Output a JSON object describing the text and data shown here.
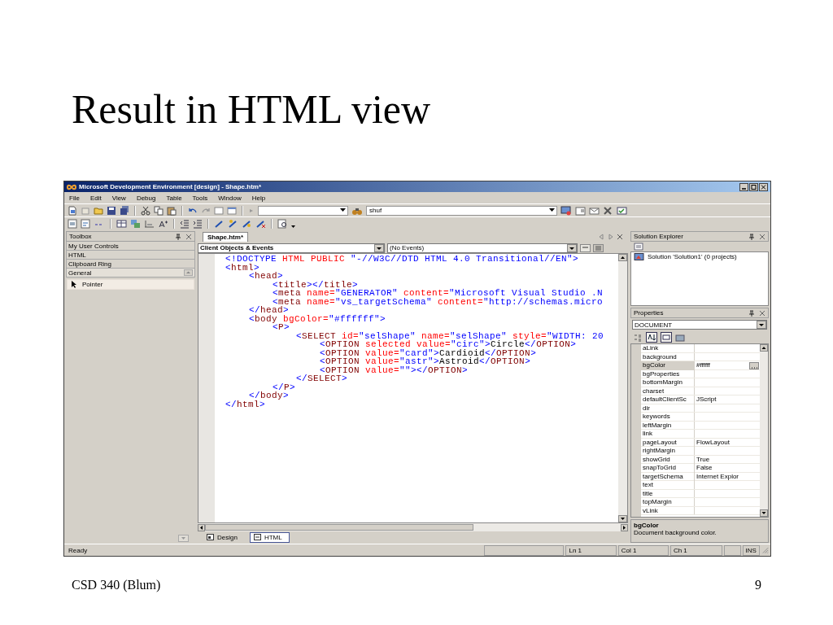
{
  "slide": {
    "title": "Result in HTML view",
    "footer": "CSD 340 (Blum)",
    "page_number": "9"
  },
  "window": {
    "title": "Microsoft Development Environment [design] - Shape.htm*"
  },
  "menu": [
    "File",
    "Edit",
    "View",
    "Debug",
    "Table",
    "Tools",
    "Window",
    "Help"
  ],
  "find_field": {
    "value": "shuf"
  },
  "toolbox": {
    "title": "Toolbox",
    "tabs": [
      {
        "label": "My User Controls",
        "selected": false
      },
      {
        "label": "HTML",
        "selected": false
      },
      {
        "label": "Clipboard Ring",
        "selected": false
      },
      {
        "label": "General",
        "selected": true
      }
    ],
    "items": [
      {
        "label": "Pointer",
        "selected": true
      }
    ]
  },
  "editor": {
    "tabs": [
      {
        "label": "Shape.htm*",
        "selected": true
      }
    ],
    "object_dropdown": "Client Objects & Events",
    "event_dropdown": "(No Events)",
    "code": [
      {
        "tokens": [
          {
            "kind": "bracket",
            "text": "<!DOCTYPE"
          },
          {
            "kind": "attr",
            "text": " HTML PUBLIC "
          },
          {
            "kind": "value",
            "text": "\"-//W3C//DTD HTML 4.0 Transitional//EN\""
          },
          {
            "kind": "bracket",
            "text": ">"
          }
        ]
      },
      {
        "tokens": [
          {
            "kind": "bracket",
            "text": "<"
          },
          {
            "kind": "tag",
            "text": "html"
          },
          {
            "kind": "bracket",
            "text": ">"
          }
        ],
        "children": [
          {
            "tokens": [
              {
                "kind": "bracket",
                "text": "<"
              },
              {
                "kind": "tag",
                "text": "head"
              },
              {
                "kind": "bracket",
                "text": ">"
              }
            ],
            "children": [
              {
                "tokens": [
                  {
                    "kind": "bracket",
                    "text": "<"
                  },
                  {
                    "kind": "tag",
                    "text": "title"
                  },
                  {
                    "kind": "bracket",
                    "text": "></"
                  },
                  {
                    "kind": "tag",
                    "text": "title"
                  },
                  {
                    "kind": "bracket",
                    "text": ">"
                  }
                ]
              },
              {
                "tokens": [
                  {
                    "kind": "bracket",
                    "text": "<"
                  },
                  {
                    "kind": "tag",
                    "text": "meta"
                  },
                  {
                    "kind": "attr",
                    "text": " name="
                  },
                  {
                    "kind": "value",
                    "text": "\"GENERATOR\""
                  },
                  {
                    "kind": "attr",
                    "text": " content="
                  },
                  {
                    "kind": "value",
                    "text": "\"Microsoft Visual Studio .N"
                  }
                ]
              },
              {
                "tokens": [
                  {
                    "kind": "bracket",
                    "text": "<"
                  },
                  {
                    "kind": "tag",
                    "text": "meta"
                  },
                  {
                    "kind": "attr",
                    "text": " name="
                  },
                  {
                    "kind": "value",
                    "text": "\"vs_targetSchema\""
                  },
                  {
                    "kind": "attr",
                    "text": " content="
                  },
                  {
                    "kind": "value",
                    "text": "\"http://schemas.micro"
                  }
                ]
              }
            ]
          },
          {
            "tokens": [
              {
                "kind": "bracket",
                "text": "</"
              },
              {
                "kind": "tag",
                "text": "head"
              },
              {
                "kind": "bracket",
                "text": ">"
              }
            ]
          },
          {
            "tokens": [
              {
                "kind": "bracket",
                "text": "<"
              },
              {
                "kind": "tag",
                "text": "body"
              },
              {
                "kind": "attr",
                "text": " bgColor="
              },
              {
                "kind": "value",
                "text": "\"#ffffff\""
              },
              {
                "kind": "bracket",
                "text": ">"
              }
            ],
            "children": [
              {
                "tokens": [
                  {
                    "kind": "bracket",
                    "text": "<"
                  },
                  {
                    "kind": "tag",
                    "text": "P"
                  },
                  {
                    "kind": "bracket",
                    "text": ">"
                  }
                ],
                "children": [
                  {
                    "tokens": [
                      {
                        "kind": "bracket",
                        "text": "<"
                      },
                      {
                        "kind": "tag",
                        "text": "SELECT"
                      },
                      {
                        "kind": "attr",
                        "text": " id="
                      },
                      {
                        "kind": "value",
                        "text": "\"selShape\""
                      },
                      {
                        "kind": "attr",
                        "text": " name="
                      },
                      {
                        "kind": "value",
                        "text": "\"selShape\""
                      },
                      {
                        "kind": "attr",
                        "text": " style="
                      },
                      {
                        "kind": "value",
                        "text": "\"WIDTH: 20"
                      }
                    ],
                    "children": [
                      {
                        "tokens": [
                          {
                            "kind": "bracket",
                            "text": "<"
                          },
                          {
                            "kind": "tag",
                            "text": "OPTION"
                          },
                          {
                            "kind": "attr",
                            "text": " selected value="
                          },
                          {
                            "kind": "value",
                            "text": "\"circ\""
                          },
                          {
                            "kind": "bracket",
                            "text": ">"
                          },
                          {
                            "kind": "text",
                            "text": "Circle"
                          },
                          {
                            "kind": "bracket",
                            "text": "</"
                          },
                          {
                            "kind": "tag",
                            "text": "OPTION"
                          },
                          {
                            "kind": "bracket",
                            "text": ">"
                          }
                        ]
                      },
                      {
                        "tokens": [
                          {
                            "kind": "bracket",
                            "text": "<"
                          },
                          {
                            "kind": "tag",
                            "text": "OPTION"
                          },
                          {
                            "kind": "attr",
                            "text": " value="
                          },
                          {
                            "kind": "value",
                            "text": "\"card\""
                          },
                          {
                            "kind": "bracket",
                            "text": ">"
                          },
                          {
                            "kind": "text",
                            "text": "Cardioid"
                          },
                          {
                            "kind": "bracket",
                            "text": "</"
                          },
                          {
                            "kind": "tag",
                            "text": "OPTION"
                          },
                          {
                            "kind": "bracket",
                            "text": ">"
                          }
                        ]
                      },
                      {
                        "tokens": [
                          {
                            "kind": "bracket",
                            "text": "<"
                          },
                          {
                            "kind": "tag",
                            "text": "OPTION"
                          },
                          {
                            "kind": "attr",
                            "text": " value="
                          },
                          {
                            "kind": "value",
                            "text": "\"astr\""
                          },
                          {
                            "kind": "bracket",
                            "text": ">"
                          },
                          {
                            "kind": "text",
                            "text": "Astroid"
                          },
                          {
                            "kind": "bracket",
                            "text": "</"
                          },
                          {
                            "kind": "tag",
                            "text": "OPTION"
                          },
                          {
                            "kind": "bracket",
                            "text": ">"
                          }
                        ]
                      },
                      {
                        "tokens": [
                          {
                            "kind": "bracket",
                            "text": "<"
                          },
                          {
                            "kind": "tag",
                            "text": "OPTION"
                          },
                          {
                            "kind": "attr",
                            "text": " value="
                          },
                          {
                            "kind": "value",
                            "text": "\"\""
                          },
                          {
                            "kind": "bracket",
                            "text": "></"
                          },
                          {
                            "kind": "tag",
                            "text": "OPTION"
                          },
                          {
                            "kind": "bracket",
                            "text": ">"
                          }
                        ]
                      }
                    ]
                  },
                  {
                    "tokens": [
                      {
                        "kind": "bracket",
                        "text": "</"
                      },
                      {
                        "kind": "tag",
                        "text": "SELECT"
                      },
                      {
                        "kind": "bracket",
                        "text": ">"
                      }
                    ]
                  }
                ]
              },
              {
                "tokens": [
                  {
                    "kind": "bracket",
                    "text": "</"
                  },
                  {
                    "kind": "tag",
                    "text": "P"
                  },
                  {
                    "kind": "bracket",
                    "text": ">"
                  }
                ]
              }
            ]
          },
          {
            "tokens": [
              {
                "kind": "bracket",
                "text": "</"
              },
              {
                "kind": "tag",
                "text": "body"
              },
              {
                "kind": "bracket",
                "text": ">"
              }
            ]
          }
        ]
      },
      {
        "tokens": [
          {
            "kind": "bracket",
            "text": "</"
          },
          {
            "kind": "tag",
            "text": "html"
          },
          {
            "kind": "bracket",
            "text": ">"
          }
        ]
      }
    ],
    "view_tabs": [
      {
        "label": "Design",
        "selected": false
      },
      {
        "label": "HTML",
        "selected": true
      }
    ]
  },
  "solution_explorer": {
    "title": "Solution Explorer",
    "items": [
      {
        "label": "Solution 'Solution1' (0 projects)"
      }
    ]
  },
  "properties": {
    "title": "Properties",
    "object": "DOCUMENT",
    "rows": [
      {
        "name": "aLink",
        "selected": false
      },
      {
        "name": "background",
        "selected": false
      },
      {
        "name": "bgColor",
        "value": "#ffffff",
        "selected": true
      },
      {
        "name": "bgProperties",
        "selected": false
      },
      {
        "name": "bottomMargin",
        "selected": false
      },
      {
        "name": "charset",
        "selected": false
      },
      {
        "name": "defaultClientSc",
        "value": "JScript",
        "selected": false
      },
      {
        "name": "dir",
        "selected": false
      },
      {
        "name": "keywords",
        "selected": false
      },
      {
        "name": "leftMargin",
        "selected": false
      },
      {
        "name": "link",
        "selected": false
      },
      {
        "name": "pageLayout",
        "value": "FlowLayout",
        "selected": false
      },
      {
        "name": "rightMargin",
        "selected": false
      },
      {
        "name": "showGrid",
        "value": "True",
        "selected": false
      },
      {
        "name": "snapToGrid",
        "value": "False",
        "selected": false
      },
      {
        "name": "targetSchema",
        "value": "Internet Explor",
        "selected": false
      },
      {
        "name": "text",
        "selected": false
      },
      {
        "name": "title",
        "selected": false
      },
      {
        "name": "topMargin",
        "selected": false
      },
      {
        "name": "vLink",
        "selected": false
      }
    ],
    "description": {
      "title": "bgColor",
      "text": "Document background color."
    }
  },
  "status_bar": {
    "message": "Ready",
    "line": "Ln 1",
    "column": "Col 1",
    "char": "Ch 1",
    "mode": "INS"
  }
}
